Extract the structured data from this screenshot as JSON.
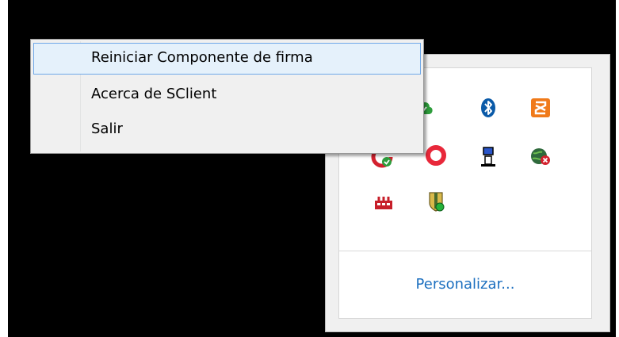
{
  "context_menu": {
    "items": [
      {
        "label": "Reiniciar Componente de firma",
        "highlighted": true
      },
      {
        "label": "Acerca de SClient",
        "highlighted": false
      },
      {
        "label": "Salir",
        "highlighted": false
      }
    ]
  },
  "tray_overflow": {
    "customize_label": "Personalizar...",
    "icons": [
      "green-cloud-icon",
      "bluetooth-icon",
      "xampp-icon",
      "antivirus-shield-icon",
      "red-ring-icon",
      "network-computer-icon",
      "network-globe-error-icon",
      "red-device-icon",
      "security-shield-icon"
    ]
  },
  "colors": {
    "link": "#1c6fbf",
    "menu_highlight_bg": "#e5f1fb",
    "menu_highlight_border": "#70a8e8",
    "bluetooth": "#0a5aa8",
    "xampp": "#f07a1a"
  }
}
